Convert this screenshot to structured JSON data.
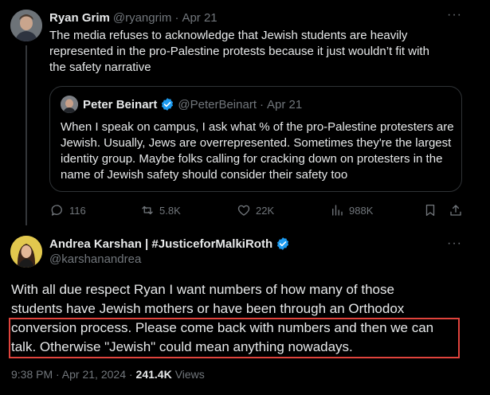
{
  "tweet1": {
    "author_name": "Ryan Grim",
    "author_handle": "@ryangrim",
    "date": "Apr 21",
    "text": "The media refuses to acknowledge that Jewish students are heavily represented in the pro-Palestine protests because it just wouldn’t fit with the safety narrative",
    "more_icon": "more-horizontal-icon"
  },
  "quote": {
    "author_name": "Peter Beinart",
    "author_handle": "@PeterBeinart",
    "date": "Apr 21",
    "text": "When I speak on campus, I ask what % of the pro-Palestine protesters are Jewish. Usually, Jews are overrepresented. Sometimes they're the largest identity group. Maybe folks calling for cracking down on protesters in the name of Jewish safety should consider their safety too",
    "verified_color": "#1d9bf0"
  },
  "actions": {
    "replies": "116",
    "reposts": "5.8K",
    "likes": "22K",
    "views": "988K",
    "icons": [
      "reply-icon",
      "repost-icon",
      "like-icon",
      "views-icon",
      "bookmark-icon",
      "share-icon"
    ]
  },
  "tweet2": {
    "author_name": "Andrea Karshan | #JusticeforMalkiRoth",
    "author_handle": "@karshanandrea",
    "text_line1": "With all due respect Ryan I want numbers of how many of those",
    "text_line2": "students have Jewish mothers or have been through an Orthodox",
    "text_line3": "conversion process. Please come back with numbers and then we can",
    "text_line4": "talk. Otherwise \"Jewish\" could mean anything nowadays.",
    "time": "9:38 PM · Apr 21, 2024 ·",
    "views_count": "241.4K",
    "views_label": "Views",
    "highlight_color": "#e0433c"
  }
}
